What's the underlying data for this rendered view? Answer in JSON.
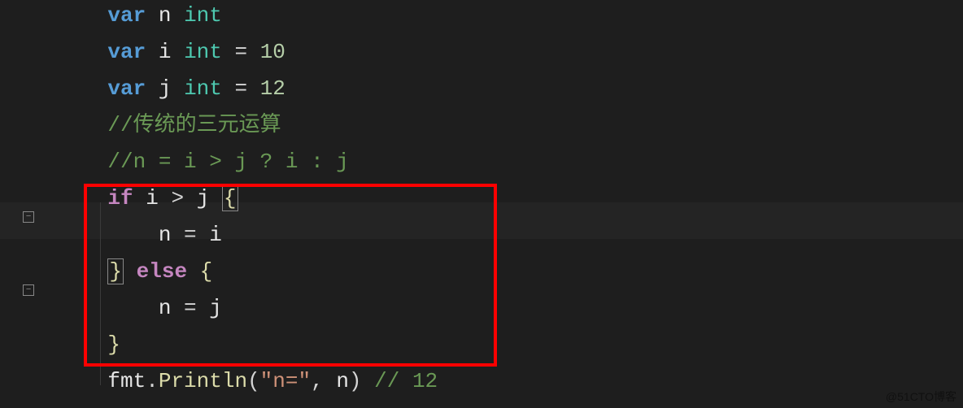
{
  "fold_symbol": "−",
  "code": {
    "l1": {
      "var": "var",
      "name": "n",
      "type": "int"
    },
    "l2": {
      "var": "var",
      "name": "i",
      "type": "int",
      "eq": "=",
      "val": "10"
    },
    "l3": {
      "var": "var",
      "name": "j",
      "type": "int",
      "eq": "=",
      "val": "12"
    },
    "l4": {
      "comment": "//传统的三元运算"
    },
    "l5": {
      "comment": "//n = i > j ? i : j"
    },
    "l6": {
      "if": "if",
      "cond_a": "i",
      "op": ">",
      "cond_b": "j",
      "brace": "{"
    },
    "l7": {
      "lhs": "n",
      "eq": "=",
      "rhs": "i"
    },
    "l8": {
      "close": "}",
      "else": "else",
      "open": "{"
    },
    "l9": {
      "lhs": "n",
      "eq": "=",
      "rhs": "j"
    },
    "l10": {
      "close": "}"
    },
    "l11": {
      "pkg": "fmt",
      "dot": ".",
      "fn": "Println",
      "lp": "(",
      "str": "\"n=\"",
      "comma": ",",
      "arg": "n",
      "rp": ")",
      "comment": "// 12"
    }
  },
  "watermark": "@51CTO博客"
}
